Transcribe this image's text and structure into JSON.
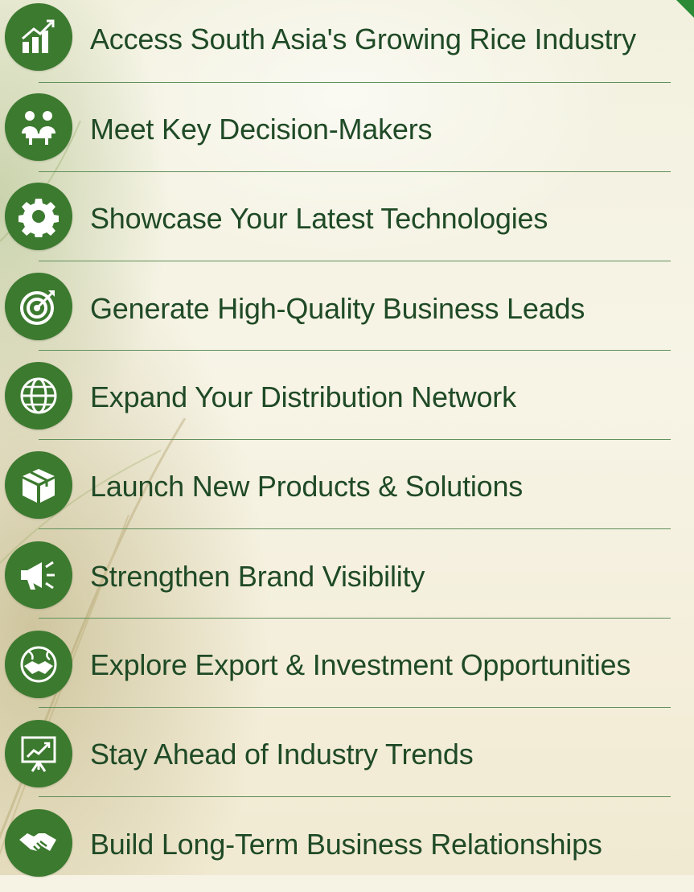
{
  "colors": {
    "icon_bg": "#3c7a2f",
    "text": "#1f4a26",
    "divider": "#5f8f5a",
    "accent": "#2a8a35"
  },
  "items": [
    {
      "label": "Access South Asia's Growing Rice Industry",
      "icon": "growth-chart-icon"
    },
    {
      "label": "Meet Key Decision-Makers",
      "icon": "meeting-people-icon"
    },
    {
      "label": "Showcase Your Latest Technologies",
      "icon": "gear-icon"
    },
    {
      "label": "Generate High-Quality Business Leads",
      "icon": "target-icon"
    },
    {
      "label": "Expand Your Distribution Network",
      "icon": "globe-icon"
    },
    {
      "label": "Launch New Products & Solutions",
      "icon": "product-box-icon"
    },
    {
      "label": "Strengthen Brand Visibility",
      "icon": "megaphone-icon"
    },
    {
      "label": "Explore Export & Investment Opportunities",
      "icon": "global-handshake-icon"
    },
    {
      "label": "Stay Ahead of Industry Trends",
      "icon": "presentation-board-icon"
    },
    {
      "label": "Build Long-Term Business Relationships",
      "icon": "handshake-icon"
    }
  ]
}
